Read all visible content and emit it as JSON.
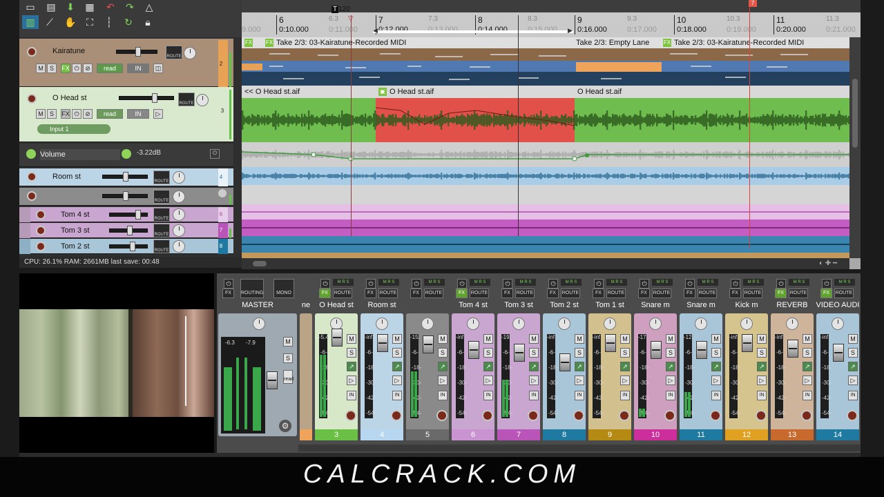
{
  "transport": {
    "tempo_marker": "120",
    "marker_num": "7"
  },
  "ruler": {
    "marks": [
      {
        "bar": "6",
        "time": "0:10.000"
      },
      {
        "bar": "7",
        "time": "0:12.000"
      },
      {
        "bar": "8",
        "time": "0:14.000"
      },
      {
        "bar": "9",
        "time": "0:16.000"
      },
      {
        "bar": "10",
        "time": "0:18.000"
      },
      {
        "bar": "11",
        "time": "0:20.000"
      }
    ],
    "subs": [
      {
        "bar": "6.3",
        "time": "0:11.000"
      },
      {
        "bar": "7.3",
        "time": "0:13.000"
      },
      {
        "bar": "8.3",
        "time": "0:15.000"
      },
      {
        "bar": "9.3",
        "time": "0:17.000"
      },
      {
        "bar": "10.3",
        "time": "0:19.000"
      },
      {
        "bar": "11.3",
        "time": "0:21.000"
      }
    ],
    "left_partial": "9.000"
  },
  "tracks": {
    "kairatune": {
      "name": "Kairatune",
      "num": "2",
      "m": "M",
      "s": "S",
      "fx": "FX",
      "read": "read",
      "in": "IN"
    },
    "ohead": {
      "name": "O Head st",
      "num": "3",
      "m": "M",
      "s": "S",
      "fx": "FX",
      "read": "read",
      "in": "IN",
      "input": "Input 1"
    },
    "volume": {
      "name": "Volume",
      "value": "-3.22dB"
    },
    "room": {
      "name": "Room st",
      "num": "4"
    },
    "folder": {
      "num": "5"
    },
    "tom4": {
      "name": "Tom 4 st",
      "num": "6"
    },
    "tom3": {
      "name": "Tom 3 st",
      "num": "7"
    },
    "tom2": {
      "name": "Tom 2 st",
      "num": "8"
    }
  },
  "items": {
    "midi1": "Take 2/3: 03-Kairatune-Recorded MIDI",
    "empty": "Take 2/3: Empty Lane",
    "midi2": "Take 2/3: 03-Kairatune-Recorded MIDI",
    "audio1": "<< O Head st.aif",
    "audio2": "O Head st.aif",
    "audio3": "O Head st.aif"
  },
  "route_label": "ROUTE",
  "status": "CPU: 26.1%  RAM: 2661MB  last save: 00:48",
  "mixer": {
    "master": {
      "name": "MASTER",
      "routing": "ROUTING",
      "mono": "MONO",
      "m": "M",
      "s": "S",
      "read": "read",
      "peaks": [
        "-6.3",
        "-7.9"
      ]
    },
    "strips": [
      {
        "name": "ne",
        "num": "",
        "color": "#f0a35a",
        "body": "#b9a488"
      },
      {
        "name": "O Head st",
        "num": "3",
        "color": "#6ac044",
        "body": "#d6e8c8",
        "db": "-5.4"
      },
      {
        "name": "Room st",
        "num": "4",
        "color": "#b7d6ef",
        "body": "#bcd5e6",
        "db": "-inf"
      },
      {
        "name": "",
        "num": "5",
        "color": "#6a6a6a",
        "body": "#8a8a8a",
        "db": "-15."
      },
      {
        "name": "Tom 4 st",
        "num": "6",
        "color": "#c993d1",
        "body": "#c9a6cf",
        "db": "-inf"
      },
      {
        "name": "Tom 3 st",
        "num": "7",
        "color": "#b954b9",
        "body": "#c9a6cf",
        "db": "-19."
      },
      {
        "name": "Tom 2 st",
        "num": "8",
        "color": "#1e7aa0",
        "body": "#a8c6d8",
        "db": "-inf"
      },
      {
        "name": "Tom 1 st",
        "num": "9",
        "color": "#b58a12",
        "body": "#d2c08e",
        "db": "-inf"
      },
      {
        "name": "Snare m",
        "num": "10",
        "color": "#cc2f9c",
        "body": "#cf9fbf",
        "db": "-17."
      },
      {
        "name": "Snare m",
        "num": "11",
        "color": "#1e7aa0",
        "body": "#a8c6d8",
        "db": "-12."
      },
      {
        "name": "Kick m",
        "num": "12",
        "color": "#e0a021",
        "body": "#d6c48e",
        "db": "-inf"
      },
      {
        "name": "REVERB",
        "num": "13",
        "color": "#c86a2e",
        "body": "#cfb49c",
        "db": "-inf"
      },
      {
        "name": "VIDEO AUDI",
        "num": "14",
        "color": "#1e7aa0",
        "body": "#a8c6d8",
        "db": "-inf"
      }
    ],
    "scale": [
      "-6-",
      "-18-",
      "-30-",
      "-42-",
      "-54-"
    ]
  },
  "brand": "CALCRACK.COM"
}
